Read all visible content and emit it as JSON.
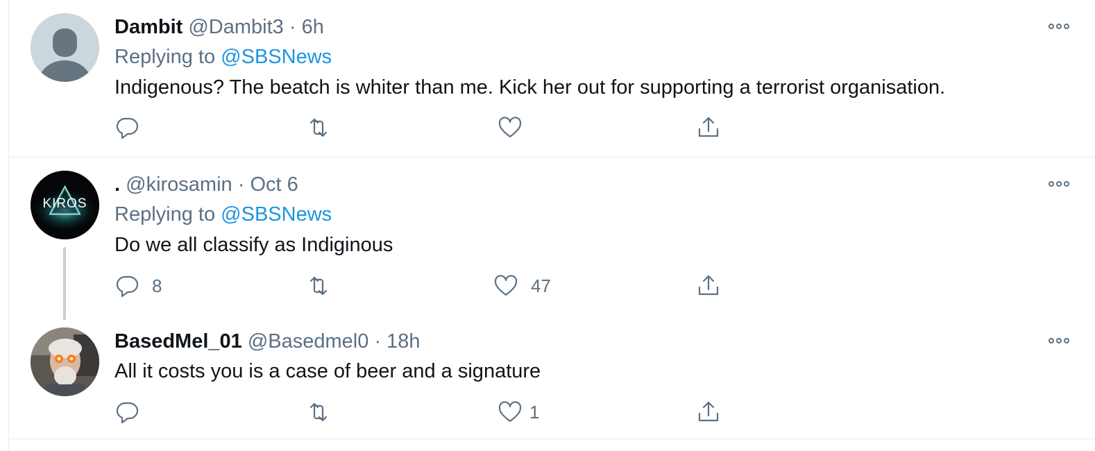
{
  "tweets": [
    {
      "name": "Dambit",
      "handle": "@Dambit3",
      "separator": "·",
      "time": "6h",
      "replying_prefix": "Replying to",
      "replying_to": "@SBSNews",
      "text": "Indigenous? The beatch is whiter than me. Kick her out for supporting a terrorist organisation.",
      "reply_count": "",
      "retweet_count": "",
      "like_count": "",
      "avatar": "default-profile"
    },
    {
      "name": ".",
      "handle": "@kirosamin",
      "separator": "·",
      "time": "Oct 6",
      "replying_prefix": "Replying to",
      "replying_to": "@SBSNews",
      "text": "Do we all classify as Indiginous",
      "reply_count": "8",
      "retweet_count": "",
      "like_count": "47",
      "avatar": "kiros-logo",
      "avatar_text": "KIROS"
    },
    {
      "name": "BasedMel_01",
      "handle": "@Basedmel0",
      "separator": "·",
      "time": "18h",
      "text": "All it costs you is a case of beer and a signature",
      "reply_count": "",
      "retweet_count": "",
      "like_count": "1",
      "avatar": "photo-man-glowing-eyes"
    }
  ],
  "colors": {
    "text": "#0f1419",
    "secondary": "#5b7083",
    "link": "#1b95e0",
    "border": "#e6ecf0",
    "thread_line": "#c4cfd6"
  }
}
